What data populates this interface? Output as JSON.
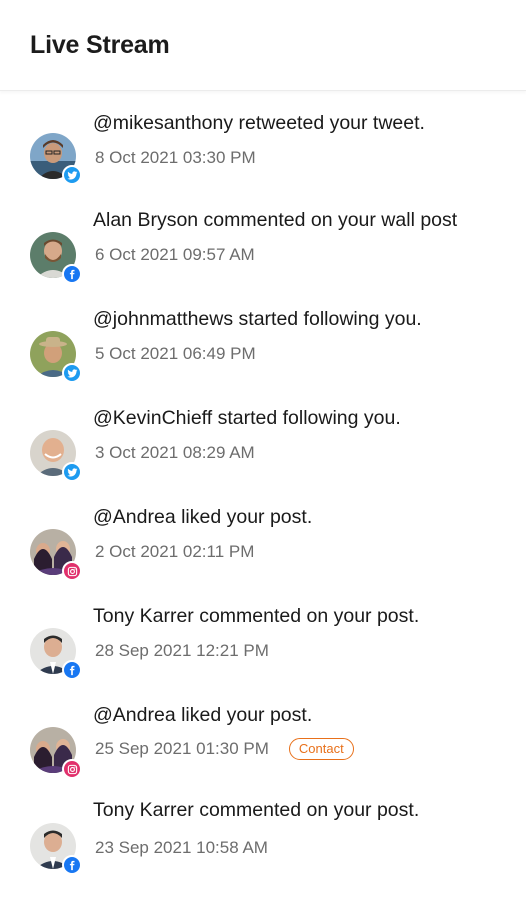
{
  "header": {
    "title": "Live Stream"
  },
  "feed": [
    {
      "text": "@mikesanthony retweeted your tweet.",
      "time": "8 Oct 2021 03:30 PM",
      "network": "twitter",
      "avatar": "person-with-glasses"
    },
    {
      "text": "Alan Bryson commented on your wall post",
      "time": "6 Oct 2021 09:57 AM",
      "network": "facebook",
      "avatar": "bearded-person"
    },
    {
      "text": "@johnmatthews started following you.",
      "time": "5 Oct 2021 06:49 PM",
      "network": "twitter",
      "avatar": "person-with-hat"
    },
    {
      "text": "@KevinChieff started following you.",
      "time": "3 Oct 2021 08:29 AM",
      "network": "twitter",
      "avatar": "bald-smiling-person"
    },
    {
      "text": "@Andrea liked your post.",
      "time": "2 Oct 2021 02:11 PM",
      "network": "instagram",
      "avatar": "group-of-women"
    },
    {
      "text": "Tony Karrer commented on your post.",
      "time": "28 Sep 2021 12:21 PM",
      "network": "facebook",
      "avatar": "man-in-suit"
    },
    {
      "text": "@Andrea liked your post.",
      "time": "25 Sep 2021 01:30 PM",
      "network": "instagram",
      "avatar": "group-of-women",
      "tag": "Contact"
    },
    {
      "text": "Tony Karrer commented on your post.",
      "time": "23 Sep 2021 10:58 AM",
      "network": "facebook",
      "avatar": "man-in-suit"
    }
  ],
  "colors": {
    "twitter": "#1d9bf0",
    "facebook": "#1877f2",
    "instagram": "#e1306c",
    "contact_tag": "#e8701a"
  }
}
